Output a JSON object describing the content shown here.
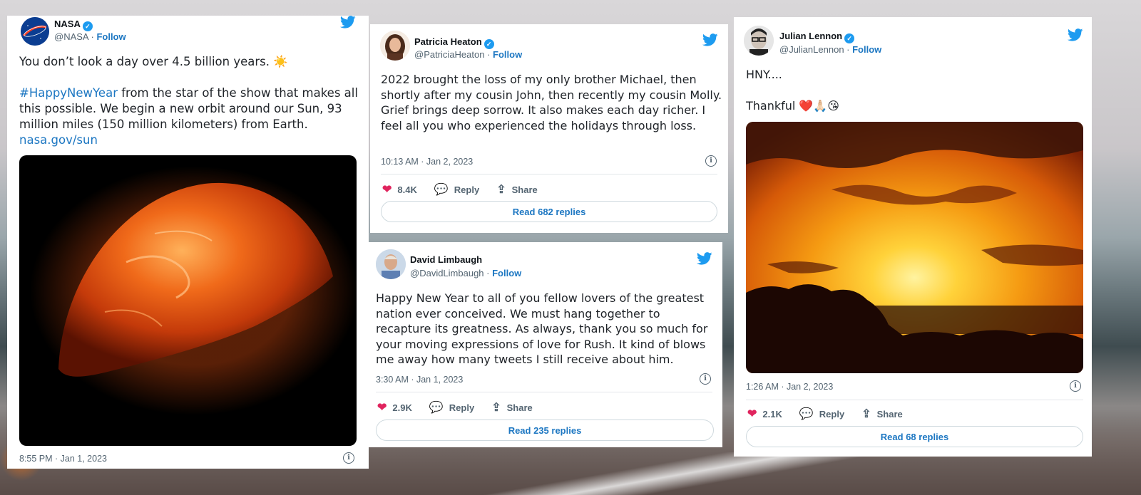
{
  "nasa": {
    "name": "NASA",
    "handle": "@NASA",
    "follow": "Follow",
    "text_line1": "You don’t look a day over 4.5 billion years. ☀️",
    "hashtag": "#HappyNewYear",
    "text_rest": " from the star of the show that makes all this possible. We begin a new orbit around our Sun, 93 million miles (150 million kilometers) from Earth.",
    "link": "nasa.gov/sun",
    "timestamp": "8:55 PM · Jan 1, 2023"
  },
  "heaton": {
    "name": "Patricia Heaton",
    "handle": "@PatriciaHeaton",
    "follow": "Follow",
    "text": "2022 brought the loss of my only brother Michael, then shortly after my cousin John, then recently my cousin Molly. Grief brings deep sorrow. It also makes each day richer. I feel all you who experienced the holidays through loss.",
    "timestamp": "10:13 AM · Jan 2, 2023",
    "likes": "8.4K",
    "reply": "Reply",
    "share": "Share",
    "read": "Read 682 replies"
  },
  "limbaugh": {
    "name": "David Limbaugh",
    "handle": "@DavidLimbaugh",
    "follow": "Follow",
    "text": "Happy New Year to all of you fellow lovers of the greatest nation ever conceived. We must hang together to recapture its greatness. As always, thank you so much for your moving expressions of love for Rush. It kind of blows me away how many tweets I still receive about him.",
    "timestamp": "3:30 AM · Jan 1, 2023",
    "likes": "2.9K",
    "reply": "Reply",
    "share": "Share",
    "read": "Read 235 replies"
  },
  "lennon": {
    "name": "Julian Lennon",
    "handle": "@JulianLennon",
    "follow": "Follow",
    "text_line1": "HNY....",
    "text_line2": "Thankful ❤️🙏🏻😘",
    "timestamp": "1:26 AM · Jan 2, 2023",
    "likes": "2.1K",
    "reply": "Reply",
    "share": "Share",
    "read": "Read 68 replies"
  },
  "separator": " · ",
  "icons": {
    "verified": "verified-badge-icon",
    "bird": "twitter-bird-icon",
    "info": "info-icon",
    "heart": "heart-icon",
    "reply": "reply-bubble-icon",
    "share": "share-icon"
  },
  "colors": {
    "twitter_blue": "#1d9bf0",
    "link_blue": "#1d77c2",
    "like_red": "#e0245e"
  }
}
